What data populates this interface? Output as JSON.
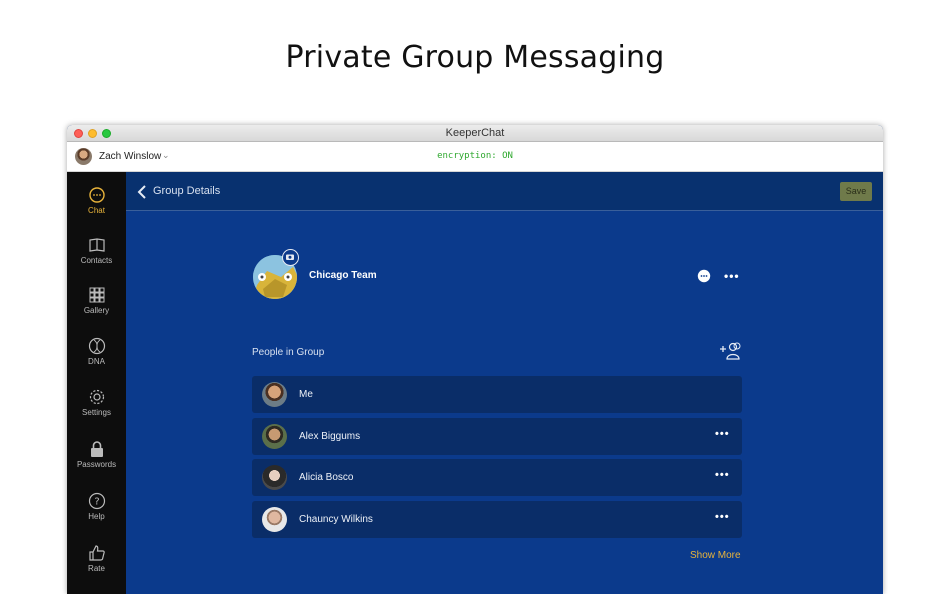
{
  "page": {
    "headline": "Private Group Messaging"
  },
  "window": {
    "title": "KeeperChat"
  },
  "userbar": {
    "user_name": "Zach Winslow",
    "encryption_status": "encryption: ON"
  },
  "sidebar": {
    "items": [
      {
        "label": "Chat",
        "icon": "chat-icon",
        "active": true
      },
      {
        "label": "Contacts",
        "icon": "book-icon"
      },
      {
        "label": "Gallery",
        "icon": "grid-icon"
      },
      {
        "label": "DNA",
        "icon": "dna-icon"
      },
      {
        "label": "Settings",
        "icon": "gear-icon"
      },
      {
        "label": "Passwords",
        "icon": "lock-icon"
      },
      {
        "label": "Help",
        "icon": "help-icon"
      },
      {
        "label": "Rate",
        "icon": "thumbs-up-icon"
      }
    ]
  },
  "header": {
    "title": "Group Details",
    "save_label": "Save"
  },
  "group": {
    "name": "Chicago Team"
  },
  "people": {
    "label": "People in Group",
    "members": [
      {
        "name": "Me",
        "has_menu": false
      },
      {
        "name": "Alex Biggums",
        "has_menu": true
      },
      {
        "name": "Alicia Bosco",
        "has_menu": true
      },
      {
        "name": "Chauncy Wilkins",
        "has_menu": true
      }
    ],
    "show_more": "Show More"
  },
  "colors": {
    "accent": "#e9b43b",
    "background": "#0b3a8c",
    "sidebar": "#0d0d0d",
    "encryption_text": "#2fa82f"
  }
}
